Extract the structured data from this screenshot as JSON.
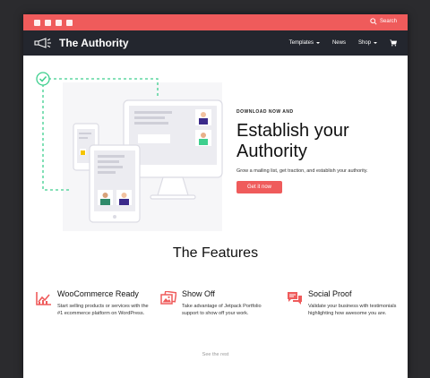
{
  "topbar": {
    "search_label": "Search",
    "social_icons": [
      "facebook-icon",
      "twitter-icon",
      "instagram-icon",
      "youtube-icon"
    ]
  },
  "nav": {
    "brand": "The Authority",
    "items": [
      {
        "label": "Templates",
        "dropdown": true
      },
      {
        "label": "News",
        "dropdown": false
      },
      {
        "label": "Shop",
        "dropdown": true
      }
    ]
  },
  "hero": {
    "eyebrow": "DOWNLOAD NOW AND",
    "headline_line1": "Establish your",
    "headline_line2": "Authority",
    "subtext": "Grow a mailing list, get traction, and establish your authority.",
    "cta": "Get it now"
  },
  "features": {
    "title": "The Features",
    "items": [
      {
        "title": "WooCommerce Ready",
        "desc": "Start selling products or services with the #1 ecommerce platform on WordPress."
      },
      {
        "title": "Show Off",
        "desc": "Take advantage of Jetpack Portfolio support to show off your work."
      },
      {
        "title": "Social Proof",
        "desc": "Validate your business with testimonials highlighting how awesome you are."
      }
    ],
    "see_rest": "See the rest"
  },
  "colors": {
    "accent": "#ef5b5b",
    "nav_bg": "#23262e",
    "check_green": "#3ecf8e"
  }
}
